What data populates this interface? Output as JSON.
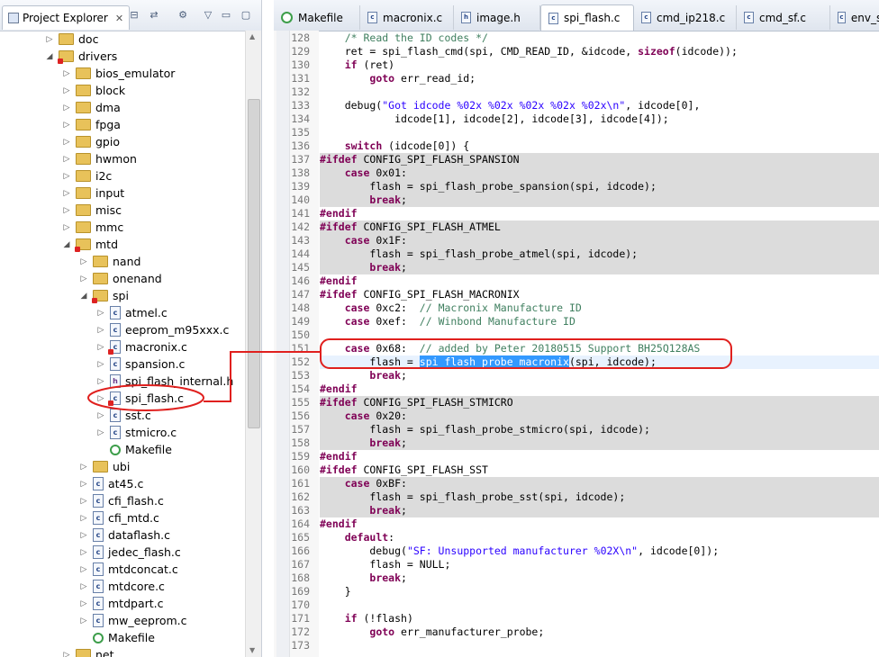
{
  "explorer": {
    "title": "Project Explorer",
    "close": "✕",
    "tree": [
      {
        "label": "doc",
        "kind": "folder",
        "depth": 3,
        "arrow": "▷",
        "err": false
      },
      {
        "label": "drivers",
        "kind": "folder",
        "depth": 3,
        "arrow": "◢",
        "err": true
      },
      {
        "label": "bios_emulator",
        "kind": "folder",
        "depth": 4,
        "arrow": "▷",
        "err": false
      },
      {
        "label": "block",
        "kind": "folder",
        "depth": 4,
        "arrow": "▷",
        "err": false
      },
      {
        "label": "dma",
        "kind": "folder",
        "depth": 4,
        "arrow": "▷",
        "err": false
      },
      {
        "label": "fpga",
        "kind": "folder",
        "depth": 4,
        "arrow": "▷",
        "err": false
      },
      {
        "label": "gpio",
        "kind": "folder",
        "depth": 4,
        "arrow": "▷",
        "err": false
      },
      {
        "label": "hwmon",
        "kind": "folder",
        "depth": 4,
        "arrow": "▷",
        "err": false
      },
      {
        "label": "i2c",
        "kind": "folder",
        "depth": 4,
        "arrow": "▷",
        "err": false
      },
      {
        "label": "input",
        "kind": "folder",
        "depth": 4,
        "arrow": "▷",
        "err": false
      },
      {
        "label": "misc",
        "kind": "folder",
        "depth": 4,
        "arrow": "▷",
        "err": false
      },
      {
        "label": "mmc",
        "kind": "folder",
        "depth": 4,
        "arrow": "▷",
        "err": false
      },
      {
        "label": "mtd",
        "kind": "folder",
        "depth": 4,
        "arrow": "◢",
        "err": true
      },
      {
        "label": "nand",
        "kind": "folder",
        "depth": 5,
        "arrow": "▷",
        "err": false
      },
      {
        "label": "onenand",
        "kind": "folder",
        "depth": 5,
        "arrow": "▷",
        "err": false
      },
      {
        "label": "spi",
        "kind": "folder",
        "depth": 5,
        "arrow": "◢",
        "err": true
      },
      {
        "label": "atmel.c",
        "kind": "c",
        "depth": 6,
        "arrow": "▷",
        "err": false
      },
      {
        "label": "eeprom_m95xxx.c",
        "kind": "c",
        "depth": 6,
        "arrow": "▷",
        "err": false
      },
      {
        "label": "macronix.c",
        "kind": "c",
        "depth": 6,
        "arrow": "▷",
        "err": true
      },
      {
        "label": "spansion.c",
        "kind": "c",
        "depth": 6,
        "arrow": "▷",
        "err": false
      },
      {
        "label": "spi_flash_internal.h",
        "kind": "h",
        "depth": 6,
        "arrow": "▷",
        "err": false
      },
      {
        "label": "spi_flash.c",
        "kind": "c",
        "depth": 6,
        "arrow": "▷",
        "err": true
      },
      {
        "label": "sst.c",
        "kind": "c",
        "depth": 6,
        "arrow": "▷",
        "err": false
      },
      {
        "label": "stmicro.c",
        "kind": "c",
        "depth": 6,
        "arrow": "▷",
        "err": false
      },
      {
        "label": "Makefile",
        "kind": "mk",
        "depth": 6,
        "arrow": "",
        "err": false
      },
      {
        "label": "ubi",
        "kind": "folder",
        "depth": 5,
        "arrow": "▷",
        "err": false
      },
      {
        "label": "at45.c",
        "kind": "c",
        "depth": 5,
        "arrow": "▷",
        "err": false
      },
      {
        "label": "cfi_flash.c",
        "kind": "c",
        "depth": 5,
        "arrow": "▷",
        "err": false
      },
      {
        "label": "cfi_mtd.c",
        "kind": "c",
        "depth": 5,
        "arrow": "▷",
        "err": false
      },
      {
        "label": "dataflash.c",
        "kind": "c",
        "depth": 5,
        "arrow": "▷",
        "err": false
      },
      {
        "label": "jedec_flash.c",
        "kind": "c",
        "depth": 5,
        "arrow": "▷",
        "err": false
      },
      {
        "label": "mtdconcat.c",
        "kind": "c",
        "depth": 5,
        "arrow": "▷",
        "err": false
      },
      {
        "label": "mtdcore.c",
        "kind": "c",
        "depth": 5,
        "arrow": "▷",
        "err": false
      },
      {
        "label": "mtdpart.c",
        "kind": "c",
        "depth": 5,
        "arrow": "▷",
        "err": false
      },
      {
        "label": "mw_eeprom.c",
        "kind": "c",
        "depth": 5,
        "arrow": "▷",
        "err": false
      },
      {
        "label": "Makefile",
        "kind": "mk",
        "depth": 5,
        "arrow": "",
        "err": false
      },
      {
        "label": "net",
        "kind": "folder",
        "depth": 4,
        "arrow": "▷",
        "err": false
      }
    ]
  },
  "editor": {
    "tabs": [
      {
        "label": "Makefile",
        "icon": "mk",
        "active": false
      },
      {
        "label": "macronix.c",
        "icon": "c",
        "active": false
      },
      {
        "label": "image.h",
        "icon": "h",
        "active": false
      },
      {
        "label": "spi_flash.c",
        "icon": "c",
        "active": true
      },
      {
        "label": "cmd_ip218.c",
        "icon": "c",
        "active": false
      },
      {
        "label": "cmd_sf.c",
        "icon": "c",
        "active": false
      },
      {
        "label": "env_sf.c",
        "icon": "c",
        "active": false
      }
    ],
    "lines": [
      {
        "n": "128",
        "inactive": false,
        "html": "    <span class=\"cm\">/* Read the ID codes */</span>"
      },
      {
        "n": "129",
        "inactive": false,
        "html": "    ret = spi_flash_cmd(spi, CMD_READ_ID, &amp;idcode, <span class=\"kw\">sizeof</span>(idcode));"
      },
      {
        "n": "130",
        "inactive": false,
        "html": "    <span class=\"kw\">if</span> (ret)"
      },
      {
        "n": "131",
        "inactive": false,
        "html": "        <span class=\"kw\">goto</span> err_read_id;"
      },
      {
        "n": "132",
        "inactive": false,
        "html": ""
      },
      {
        "n": "133",
        "inactive": false,
        "html": "    debug(<span class=\"st\">\"Got idcode %02x %02x %02x %02x %02x\\n\"</span>, idcode[0],"
      },
      {
        "n": "134",
        "inactive": false,
        "html": "            idcode[1], idcode[2], idcode[3], idcode[4]);"
      },
      {
        "n": "135",
        "inactive": false,
        "html": ""
      },
      {
        "n": "136",
        "inactive": false,
        "html": "    <span class=\"kw\">switch</span> (idcode[0]) {"
      },
      {
        "n": "137",
        "inactive": true,
        "html": "<span class=\"pp\">#ifdef</span> CONFIG_SPI_FLASH_SPANSION"
      },
      {
        "n": "138",
        "inactive": true,
        "html": "    <span class=\"kw\">case</span> 0x01:"
      },
      {
        "n": "139",
        "inactive": true,
        "html": "        flash = spi_flash_probe_spansion(spi, idcode);"
      },
      {
        "n": "140",
        "inactive": true,
        "html": "        <span class=\"kw\">break</span>;"
      },
      {
        "n": "141",
        "inactive": false,
        "html": "<span class=\"pp\">#endif</span>"
      },
      {
        "n": "142",
        "inactive": true,
        "html": "<span class=\"pp\">#ifdef</span> CONFIG_SPI_FLASH_ATMEL"
      },
      {
        "n": "143",
        "inactive": true,
        "html": "    <span class=\"kw\">case</span> 0x1F:"
      },
      {
        "n": "144",
        "inactive": true,
        "html": "        flash = spi_flash_probe_atmel(spi, idcode);"
      },
      {
        "n": "145",
        "inactive": true,
        "html": "        <span class=\"kw\">break</span>;"
      },
      {
        "n": "146",
        "inactive": false,
        "html": "<span class=\"pp\">#endif</span>"
      },
      {
        "n": "147",
        "inactive": false,
        "html": "<span class=\"pp\">#ifdef</span> CONFIG_SPI_FLASH_MACRONIX"
      },
      {
        "n": "148",
        "inactive": false,
        "html": "    <span class=\"kw\">case</span> 0xc2:  <span class=\"cm\">// Macronix Manufacture ID</span>"
      },
      {
        "n": "149",
        "inactive": false,
        "html": "    <span class=\"kw\">case</span> 0xef:  <span class=\"cm\">// Winbond Manufacture ID</span>"
      },
      {
        "n": "150",
        "inactive": false,
        "html": ""
      },
      {
        "n": "151",
        "inactive": false,
        "html": "    <span class=\"kw\">case</span> 0x68:  <span class=\"cm\">// added by Peter 20180515 Support BH25Q128AS</span>"
      },
      {
        "n": "152",
        "inactive": false,
        "cur": true,
        "html": "        flash = <span class=\"sel\">spi_flash_probe_macronix</span>(spi, idcode);"
      },
      {
        "n": "153",
        "inactive": false,
        "html": "        <span class=\"kw\">break</span>;"
      },
      {
        "n": "154",
        "inactive": false,
        "html": "<span class=\"pp\">#endif</span>"
      },
      {
        "n": "155",
        "inactive": true,
        "html": "<span class=\"pp\">#ifdef</span> CONFIG_SPI_FLASH_STMICRO"
      },
      {
        "n": "156",
        "inactive": true,
        "html": "    <span class=\"kw\">case</span> 0x20:"
      },
      {
        "n": "157",
        "inactive": true,
        "html": "        flash = spi_flash_probe_stmicro(spi, idcode);"
      },
      {
        "n": "158",
        "inactive": true,
        "html": "        <span class=\"kw\">break</span>;"
      },
      {
        "n": "159",
        "inactive": false,
        "html": "<span class=\"pp\">#endif</span>"
      },
      {
        "n": "160",
        "inactive": false,
        "html": "<span class=\"pp\">#ifdef</span> CONFIG_SPI_FLASH_SST"
      },
      {
        "n": "161",
        "inactive": true,
        "html": "    <span class=\"kw\">case</span> 0xBF:"
      },
      {
        "n": "162",
        "inactive": true,
        "html": "        flash = spi_flash_probe_sst(spi, idcode);"
      },
      {
        "n": "163",
        "inactive": true,
        "html": "        <span class=\"kw\">break</span>;"
      },
      {
        "n": "164",
        "inactive": false,
        "html": "<span class=\"pp\">#endif</span>"
      },
      {
        "n": "165",
        "inactive": false,
        "html": "    <span class=\"kw\">default</span>:"
      },
      {
        "n": "166",
        "inactive": false,
        "html": "        debug(<span class=\"st\">\"SF: Unsupported manufacturer %02X\\n\"</span>, idcode[0]);"
      },
      {
        "n": "167",
        "inactive": false,
        "html": "        flash = NULL;"
      },
      {
        "n": "168",
        "inactive": false,
        "html": "        <span class=\"kw\">break</span>;"
      },
      {
        "n": "169",
        "inactive": false,
        "html": "    }"
      },
      {
        "n": "170",
        "inactive": false,
        "html": ""
      },
      {
        "n": "171",
        "inactive": false,
        "html": "    <span class=\"kw\">if</span> (!flash)"
      },
      {
        "n": "172",
        "inactive": false,
        "html": "        <span class=\"kw\">goto</span> err_manufacturer_probe;"
      },
      {
        "n": "173",
        "inactive": false,
        "html": ""
      }
    ]
  },
  "colors": {
    "annotation": "#e0201e",
    "selection": "#3399ff",
    "inactive_bg": "#dcdcdc"
  }
}
